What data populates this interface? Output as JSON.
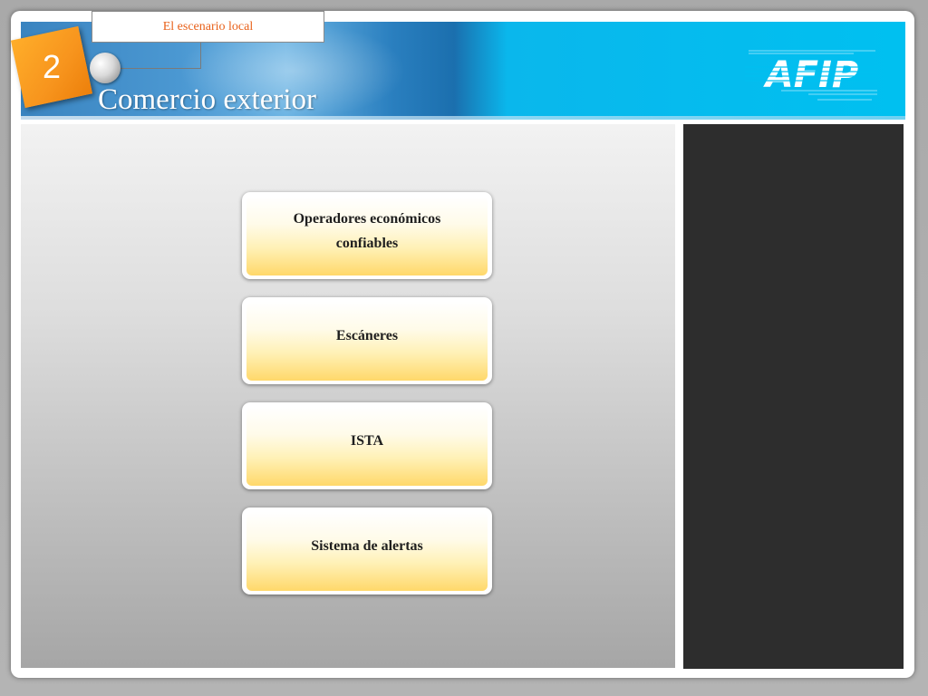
{
  "header": {
    "tab_label": "El escenario local",
    "section_number": "2",
    "title": "Comercio exterior",
    "logo_text": "AFIP"
  },
  "cards": [
    {
      "label": "Operadores económicos confiables"
    },
    {
      "label": "Escáneres"
    },
    {
      "label": "ISTA"
    },
    {
      "label": "Sistema de alertas"
    }
  ],
  "colors": {
    "header_blue": "#00c0f0",
    "badge_orange": "#f7941d",
    "tab_text": "#e8611a",
    "side_panel": "#2d2d2d",
    "card_yellow": "#ffd86a"
  }
}
